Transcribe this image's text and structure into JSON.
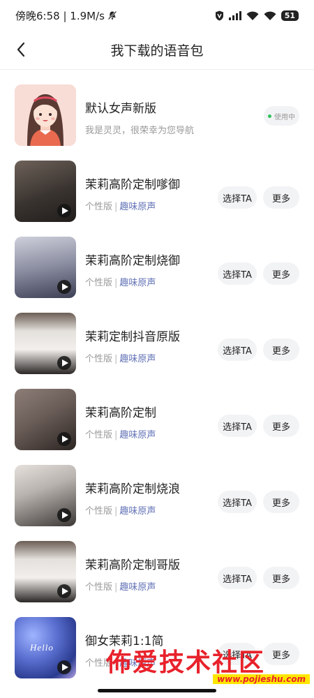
{
  "status_bar": {
    "time_speed": "傍晚6:58 | 1.9M/s",
    "battery": "51",
    "icons": [
      "mute-bell-icon",
      "vpn-icon",
      "signal-icon",
      "wifi-icon",
      "wifi-icon",
      "battery-icon"
    ]
  },
  "header": {
    "title": "我下载的语音包",
    "back_icon": "back-arrow-icon"
  },
  "default_voice": {
    "title": "默认女声新版",
    "subtitle": "我是灵灵，很荣幸为您导航",
    "status": "使用中"
  },
  "voices": [
    {
      "title": "茉莉高阶定制嗲御",
      "type": "个性版",
      "separator": "|",
      "tag": "趣味原声",
      "select_label": "选择TA",
      "more_label": "更多",
      "thumb_color": "#3a3430"
    },
    {
      "title": "茉莉高阶定制烧御",
      "type": "个性版",
      "separator": "|",
      "tag": "趣味原声",
      "select_label": "选择TA",
      "more_label": "更多",
      "thumb_color": "#8a8da0"
    },
    {
      "title": "茉莉定制抖音原版",
      "type": "个性版",
      "separator": "|",
      "tag": "趣味原声",
      "select_label": "选择TA",
      "more_label": "更多",
      "thumb_color": "#cfcac6"
    },
    {
      "title": "茉莉高阶定制",
      "type": "个性版",
      "separator": "|",
      "tag": "趣味原声",
      "select_label": "选择TA",
      "more_label": "更多",
      "thumb_color": "#6a5d58"
    },
    {
      "title": "茉莉高阶定制烧浪",
      "type": "个性版",
      "separator": "|",
      "tag": "趣味原声",
      "select_label": "选择TA",
      "more_label": "更多",
      "thumb_color": "#b8b3ae"
    },
    {
      "title": "茉莉高阶定制哥版",
      "type": "个性版",
      "separator": "|",
      "tag": "趣味原声",
      "select_label": "选择TA",
      "more_label": "更多",
      "thumb_color": "#cfcac6"
    },
    {
      "title": "御女茉莉1:1简",
      "type": "个性版",
      "separator": "|",
      "tag": "趣味原声",
      "select_label": "选择TA",
      "more_label": "更多",
      "thumb_color": "#5a6fd0",
      "thumb_text": "Hello"
    }
  ],
  "watermark": {
    "text": "佈爱技术社区",
    "url": "www.pojieshu.com"
  },
  "colors": {
    "accent_tag": "#6272b6",
    "in_use_dot": "#2ec25b",
    "button_bg": "#f2f3f5",
    "watermark_red": "#e8222b"
  }
}
